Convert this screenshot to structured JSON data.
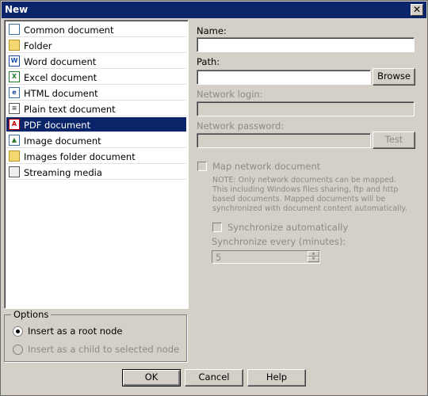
{
  "window": {
    "title": "New",
    "close": "✕"
  },
  "doc_types": [
    {
      "label": "Common document",
      "icon": "common-document-icon",
      "glyph": ""
    },
    {
      "label": "Folder",
      "icon": "folder-icon",
      "glyph": ""
    },
    {
      "label": "Word document",
      "icon": "word-document-icon",
      "glyph": "W"
    },
    {
      "label": "Excel document",
      "icon": "excel-document-icon",
      "glyph": "X"
    },
    {
      "label": "HTML document",
      "icon": "html-document-icon",
      "glyph": "e"
    },
    {
      "label": "Plain text document",
      "icon": "text-document-icon",
      "glyph": "≡"
    },
    {
      "label": "PDF document",
      "icon": "pdf-document-icon",
      "glyph": "A"
    },
    {
      "label": "Image document",
      "icon": "image-document-icon",
      "glyph": "▲"
    },
    {
      "label": "Images folder document",
      "icon": "images-folder-icon",
      "glyph": ""
    },
    {
      "label": "Streaming media",
      "icon": "streaming-media-icon",
      "glyph": ""
    }
  ],
  "selected_index": 6,
  "options": {
    "title": "Options",
    "root": "Insert as a root node",
    "child": "Insert as a child to selected node"
  },
  "form": {
    "name_label": "Name:",
    "name_value": "",
    "path_label": "Path:",
    "path_value": "",
    "browse": "Browse",
    "login_label": "Network login:",
    "password_label": "Network password:",
    "test": "Test",
    "map_label": "Map network document",
    "note": "NOTE: Only network documents can be mapped. This including Windows files sharing, ftp and http based documents. Mapped documents will be synchronized with document content automatically.",
    "sync_label": "Synchronize automatically",
    "sync_every_label": "Synchronize every (minutes):",
    "sync_every_value": "5"
  },
  "buttons": {
    "ok": "OK",
    "cancel": "Cancel",
    "help": "Help"
  },
  "colors": {
    "title_bar": "#0a246a",
    "selection": "#0a246a",
    "face": "#d4d0c8"
  }
}
